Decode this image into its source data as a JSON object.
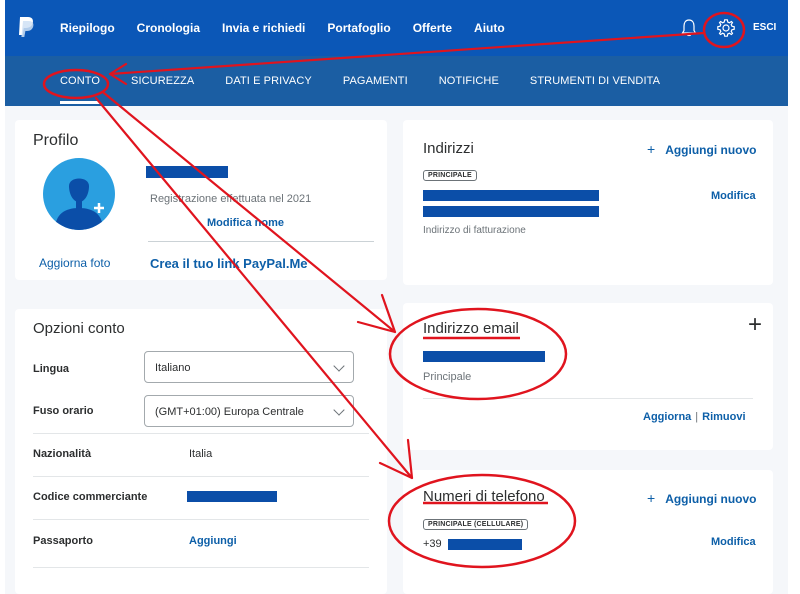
{
  "topnav": {
    "items": [
      "Riepilogo",
      "Cronologia",
      "Invia e richiedi",
      "Portafoglio",
      "Offerte",
      "Aiuto"
    ],
    "logout": "ESCI"
  },
  "subnav": {
    "items": [
      "CONTO",
      "SICUREZZA",
      "DATI E PRIVACY",
      "PAGAMENTI",
      "NOTIFICHE",
      "STRUMENTI DI VENDITA"
    ],
    "active": "CONTO"
  },
  "profile": {
    "title": "Profilo",
    "registration": "Registrazione effettuata nel 2021",
    "edit_name": "Modifica nome",
    "update_photo": "Aggiorna foto",
    "paypalme": "Crea il tuo link PayPal.Me"
  },
  "options": {
    "title": "Opzioni conto",
    "language_label": "Lingua",
    "language_value": "Italiano",
    "timezone_label": "Fuso orario",
    "timezone_value": "(GMT+01:00) Europa Centrale",
    "nationality_label": "Nazionalità",
    "nationality_value": "Italia",
    "merchant_code_label": "Codice commerciante",
    "passport_label": "Passaporto",
    "passport_action": "Aggiungi"
  },
  "addresses": {
    "title": "Indirizzi",
    "add_new": "Aggiungi nuovo",
    "badge": "PRINCIPALE",
    "edit": "Modifica",
    "caption": "Indirizzo di fatturazione"
  },
  "email": {
    "title": "Indirizzo email",
    "caption": "Principale",
    "update": "Aggiorna",
    "remove": "Rimuovi",
    "add_symbol": "+"
  },
  "phones": {
    "title": "Numeri di telefono",
    "add_new": "Aggiungi nuovo",
    "badge": "PRINCIPALE (CELLULARE)",
    "prefix": "+39",
    "edit": "Modifica"
  },
  "colors": {
    "topbar": "#0b57b7",
    "subbar": "#1b5ea3",
    "link": "#0d5fa8",
    "redacted": "#0b4ea8",
    "annotation": "#e0141e"
  },
  "icons": [
    "paypal-logo-icon",
    "bell-icon",
    "gear-icon",
    "avatar-add-icon",
    "plus-icon",
    "chevron-down-icon"
  ]
}
